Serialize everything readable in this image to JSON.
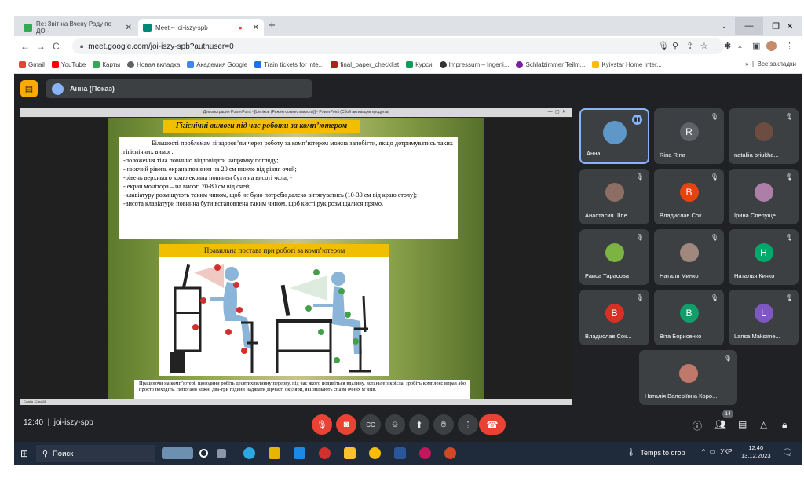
{
  "browser": {
    "tabs": [
      {
        "label": "Re: Звіт на Вчену Раду по ДО -",
        "color": "#34a853"
      },
      {
        "label": "Meet – joi-iszy-spb",
        "color": "#00897b"
      }
    ],
    "url": "meet.google.com/joi-iszy-spb?authuser=0",
    "bookmarks": [
      {
        "label": "Gmail",
        "color": "#ea4335"
      },
      {
        "label": "YouTube",
        "color": "#ff0000"
      },
      {
        "label": "Карты",
        "color": "#34a853"
      },
      {
        "label": "Новая вкладка",
        "color": "#5f6368"
      },
      {
        "label": "Академия Google",
        "color": "#4285f4"
      },
      {
        "label": "Train tickets for inte...",
        "color": "#1a73e8"
      },
      {
        "label": "final_paper_checklist",
        "color": "#b71c1c"
      },
      {
        "label": "Курси",
        "color": "#0f9d58"
      },
      {
        "label": "Impressum – Ingeni...",
        "color": "#333333"
      },
      {
        "label": "Schlafzimmer Teilm...",
        "color": "#7b1fa2"
      },
      {
        "label": "Kyivstar Home Inter...",
        "color": "#fbbc04"
      }
    ],
    "all_bookmarks": "Все закладки"
  },
  "meet": {
    "presenter": "Анна (Показ)",
    "time": "12:40",
    "meeting_code": "joi-iszy-spb",
    "participant_count": "14"
  },
  "powerpoint": {
    "window_title": "Демонстрация PowerPoint - [Целіков (Режим совместимости)] - PowerPoint (Сбой активации продукта)",
    "status": "Слайд 12 из 28"
  },
  "slide": {
    "title": "Гігієнічні вимоги під час роботи за комп’ютером",
    "intro": "Більшості проблемам зі здоров’ям через роботу за комп’ютером можна запобігти, якщо дотримуватись таких гігієнічних вимог:",
    "items": [
      "-положення тіла повинно відповідати напрямку погляду;",
      "- нижчий рівень екрана повинен на 20 см нижче від рівня очей;",
      "-рівень верхнього краю екрана повинен бути на висоті чола; -",
      "- екран монітора – на висоті 70-80 см від очей;",
      "-клавіатуру розміщують таким чином, щоб не було потреби далеко витягуватись (10-30 см від краю столу);",
      "-висота клавіатури повинна бути встановлена таким чином, щоб кисті рук розміщалися прямо."
    ],
    "subtitle": "Правильна постава при роботі за комп’ютером",
    "bottom_text": "Працюючи на комп’ютері, щогодини робіть десятихвилинну перерву, під час якого подивіться вдалину, встаньте з крісла, зробіть комплекс вправ або просто походіть. Непогано кожні два-три години надягати дірчасті окуляри, які знімають спазм очних м’язів."
  },
  "participants": [
    {
      "name": "Анна",
      "initial": "",
      "color": "#5e97c8",
      "speaking": true
    },
    {
      "name": "Rina Rina",
      "initial": "R",
      "color": "#5f6368"
    },
    {
      "name": "nataliia briukha...",
      "initial": "",
      "color": "#6d4c41"
    },
    {
      "name": "Анастасия Шпе...",
      "initial": "",
      "color": "#8d6e63"
    },
    {
      "name": "Владислав Сок...",
      "initial": "В",
      "color": "#e8430f"
    },
    {
      "name": "Ірина Слепуще...",
      "initial": "",
      "color": "#ad7fa8"
    },
    {
      "name": "Раиса Тарасова",
      "initial": "",
      "color": "#7cb342"
    },
    {
      "name": "Наталя Минко",
      "initial": "",
      "color": "#a1887f"
    },
    {
      "name": "Наталья Кичко",
      "initial": "Н",
      "color": "#00a86b"
    },
    {
      "name": "Владислав Сок...",
      "initial": "В",
      "color": "#d93025"
    },
    {
      "name": "Віта Борисенко",
      "initial": "В",
      "color": "#129e6b"
    },
    {
      "name": "Larisa Maksime...",
      "initial": "L",
      "color": "#7e57c2"
    },
    {
      "name": "Наталія Валеріївна Коро...",
      "initial": "",
      "color": "#c0786a"
    }
  ],
  "taskbar": {
    "search": "Поиск",
    "weather": "Temps to drop",
    "lang": "УКР",
    "time": "12:40",
    "date": "13.12.2023"
  }
}
